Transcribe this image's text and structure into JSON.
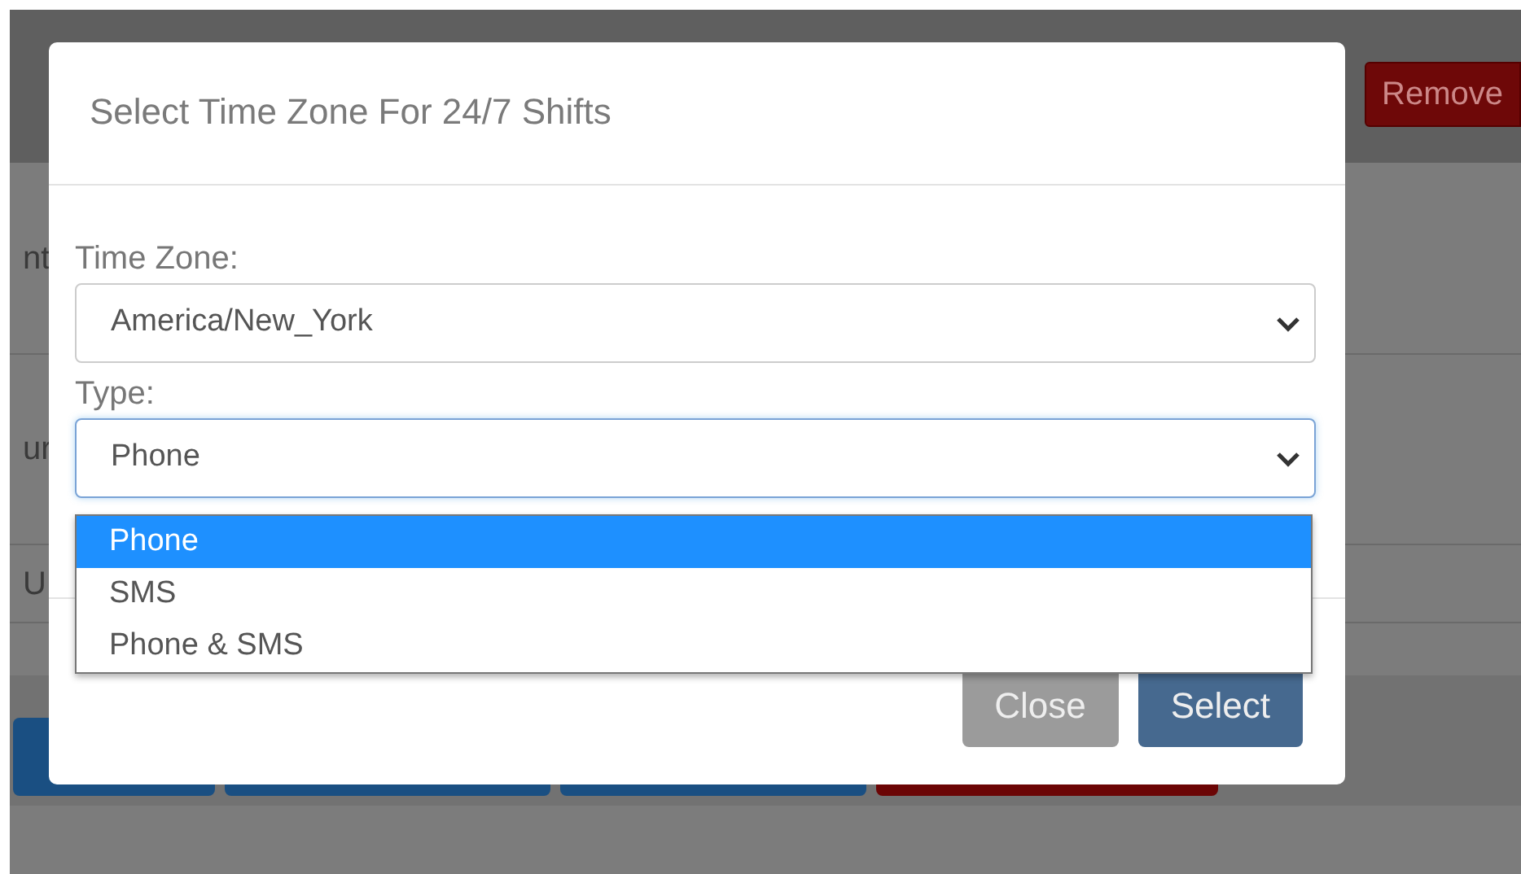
{
  "background": {
    "action_button": "Remove",
    "fragments": [
      "nt",
      "ur",
      "U"
    ],
    "buttons": [
      {
        "kind": "primary"
      },
      {
        "kind": "primary"
      },
      {
        "kind": "primary"
      },
      {
        "kind": "danger"
      }
    ]
  },
  "modal": {
    "title": "Select Time Zone For 24/7 Shifts",
    "fields": [
      {
        "label": "Time Zone:",
        "value": "America/New_York",
        "focused": false
      },
      {
        "label": "Type:",
        "value": "Phone",
        "focused": true
      }
    ],
    "dropdown": {
      "options": [
        {
          "label": "Phone",
          "selected": true
        },
        {
          "label": "SMS",
          "selected": false
        },
        {
          "label": "Phone & SMS",
          "selected": false
        }
      ]
    },
    "buttons": [
      {
        "label": "Close",
        "kind": "secondary"
      },
      {
        "label": "Select",
        "kind": "primary"
      }
    ]
  }
}
